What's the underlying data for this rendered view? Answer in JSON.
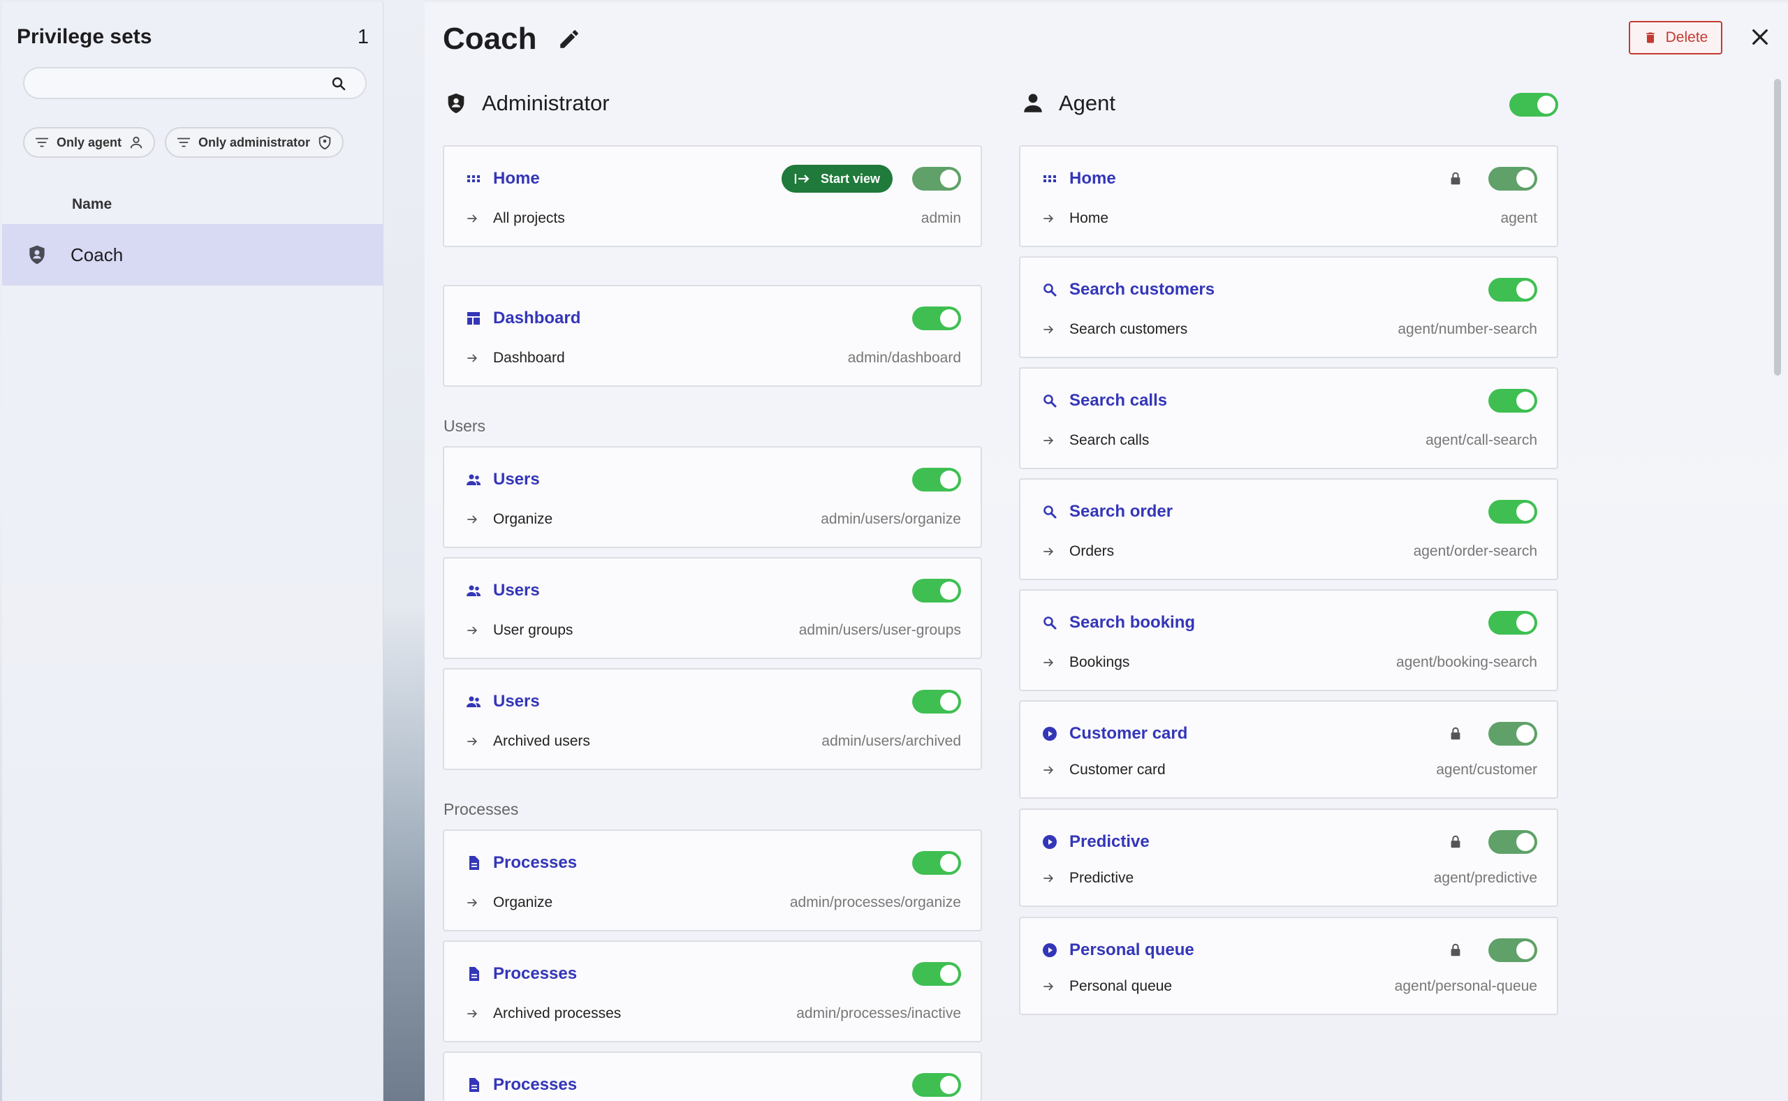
{
  "left": {
    "title": "Privilege sets",
    "count": "1",
    "search": {
      "placeholder": "",
      "value": ""
    },
    "filters": [
      {
        "label": "Only agent",
        "icon": "user-icon"
      },
      {
        "label": "Only administrator",
        "icon": "shield-icon"
      }
    ],
    "column_header": "Name",
    "rows": [
      {
        "label": "Coach",
        "icon": "shield-icon",
        "selected": true
      }
    ]
  },
  "main": {
    "title": "Coach",
    "delete_label": "Delete",
    "admin": {
      "title": "Administrator",
      "home": {
        "title": "Home",
        "start_view": "Start view",
        "sub": "All projects",
        "path": "admin"
      },
      "dashboard": {
        "title": "Dashboard",
        "sub": "Dashboard",
        "path": "admin/dashboard"
      },
      "users_group": "Users",
      "users": [
        {
          "title": "Users",
          "sub": "Organize",
          "path": "admin/users/organize"
        },
        {
          "title": "Users",
          "sub": "User groups",
          "path": "admin/users/user-groups"
        },
        {
          "title": "Users",
          "sub": "Archived users",
          "path": "admin/users/archived"
        }
      ],
      "processes_group": "Processes",
      "processes": [
        {
          "title": "Processes",
          "sub": "Organize",
          "path": "admin/processes/organize"
        },
        {
          "title": "Processes",
          "sub": "Archived processes",
          "path": "admin/processes/inactive"
        },
        {
          "title": "Processes"
        }
      ]
    },
    "agent": {
      "title": "Agent",
      "cards": [
        {
          "title": "Home",
          "sub": "Home",
          "path": "agent",
          "icon": "grid-icon",
          "locked": true
        },
        {
          "title": "Search customers",
          "sub": "Search customers",
          "path": "agent/number-search",
          "icon": "search-icon",
          "locked": false
        },
        {
          "title": "Search calls",
          "sub": "Search calls",
          "path": "agent/call-search",
          "icon": "search-icon",
          "locked": false
        },
        {
          "title": "Search order",
          "sub": "Orders",
          "path": "agent/order-search",
          "icon": "search-icon",
          "locked": false
        },
        {
          "title": "Search booking",
          "sub": "Bookings",
          "path": "agent/booking-search",
          "icon": "search-icon",
          "locked": false
        },
        {
          "title": "Customer card",
          "sub": "Customer card",
          "path": "agent/customer",
          "icon": "play-circle-icon",
          "locked": true
        },
        {
          "title": "Predictive",
          "sub": "Predictive",
          "path": "agent/predictive",
          "icon": "play-circle-icon",
          "locked": true
        },
        {
          "title": "Personal queue",
          "sub": "Personal queue",
          "path": "agent/personal-queue",
          "icon": "play-circle-icon",
          "locked": true
        }
      ]
    }
  },
  "colors": {
    "accent": "#3436b8",
    "toggle_on": "#3fbf52",
    "start_view": "#1f7a3b",
    "danger": "#c43a32",
    "selected_row": "#d8d9f3"
  }
}
